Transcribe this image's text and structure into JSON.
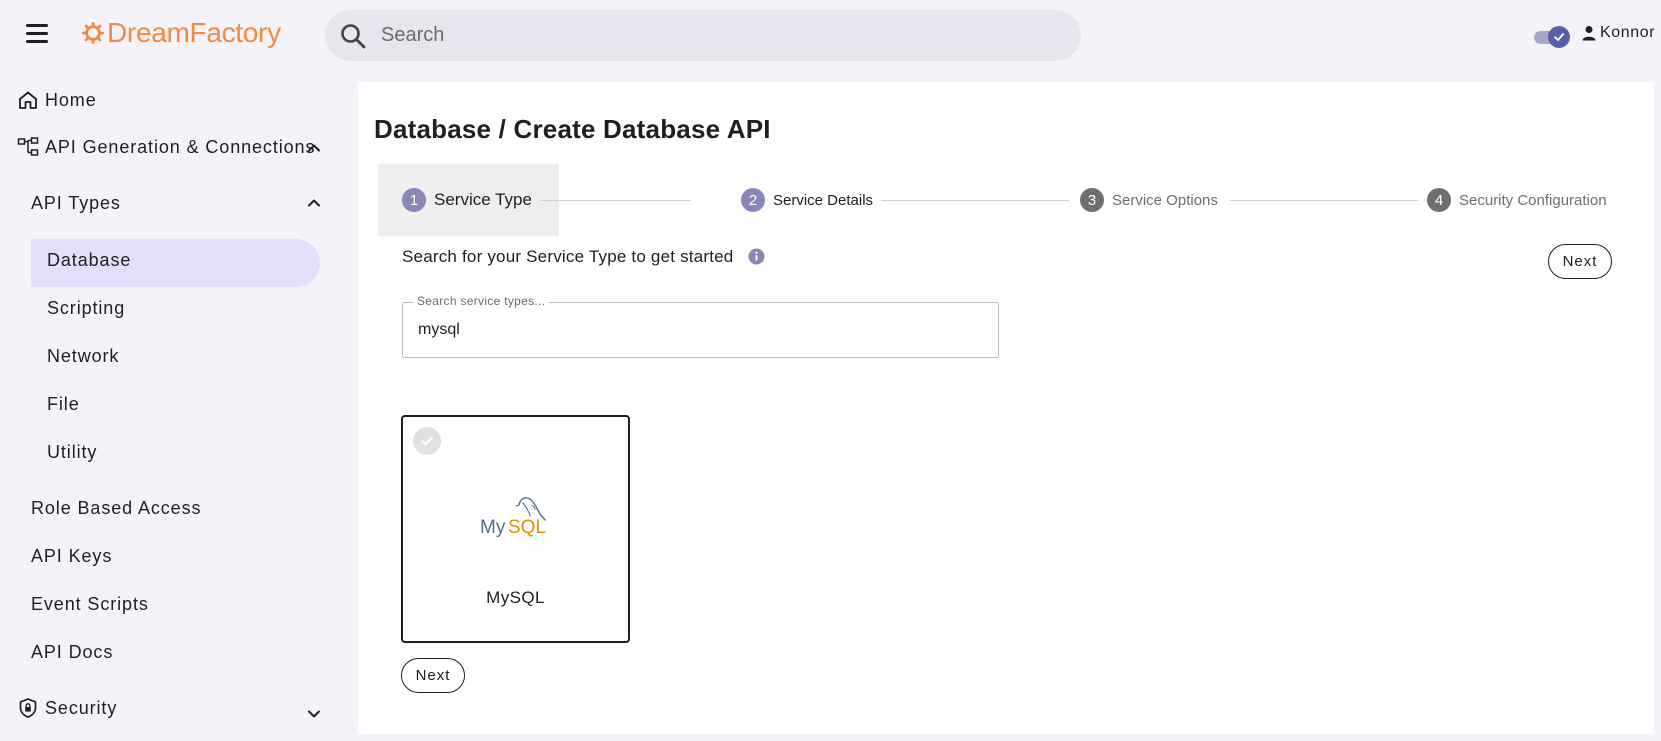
{
  "brand": {
    "name": "DreamFactory",
    "color": "#f08a45"
  },
  "header": {
    "search_placeholder": "Search",
    "user_name": "Konnor",
    "theme_toggle_state": "on"
  },
  "sidebar": {
    "items": [
      {
        "label": "Home",
        "icon": "home-icon"
      },
      {
        "label": "API Generation & Connections",
        "icon": "api-tree-icon",
        "expanded": true
      },
      {
        "label": "API Types",
        "expanded": true
      },
      {
        "label": "Database",
        "active": true
      },
      {
        "label": "Scripting"
      },
      {
        "label": "Network"
      },
      {
        "label": "File"
      },
      {
        "label": "Utility"
      },
      {
        "label": "Role Based Access"
      },
      {
        "label": "API Keys"
      },
      {
        "label": "Event Scripts"
      },
      {
        "label": "API Docs"
      },
      {
        "label": "Security",
        "icon": "security-shield-icon",
        "expanded": false
      }
    ],
    "active_color": "#e2defb"
  },
  "main": {
    "title": "Database / Create Database API",
    "steps": [
      {
        "number": "1",
        "label": "Service Type",
        "state": "active"
      },
      {
        "number": "2",
        "label": "Service Details",
        "state": "next"
      },
      {
        "number": "3",
        "label": "Service Options",
        "state": "pending"
      },
      {
        "number": "4",
        "label": "Security Configuration",
        "state": "pending"
      }
    ],
    "intro_text": "Search for your Service Type to get started",
    "next_label": "Next",
    "search_field": {
      "label": "Search service types...",
      "value": "mysql"
    },
    "results": [
      {
        "title": "MySQL",
        "logo": "mysql-logo",
        "selected": true
      }
    ],
    "colors": {
      "step_active": "#8a86b8",
      "step_pending": "#6e6e6e"
    }
  }
}
